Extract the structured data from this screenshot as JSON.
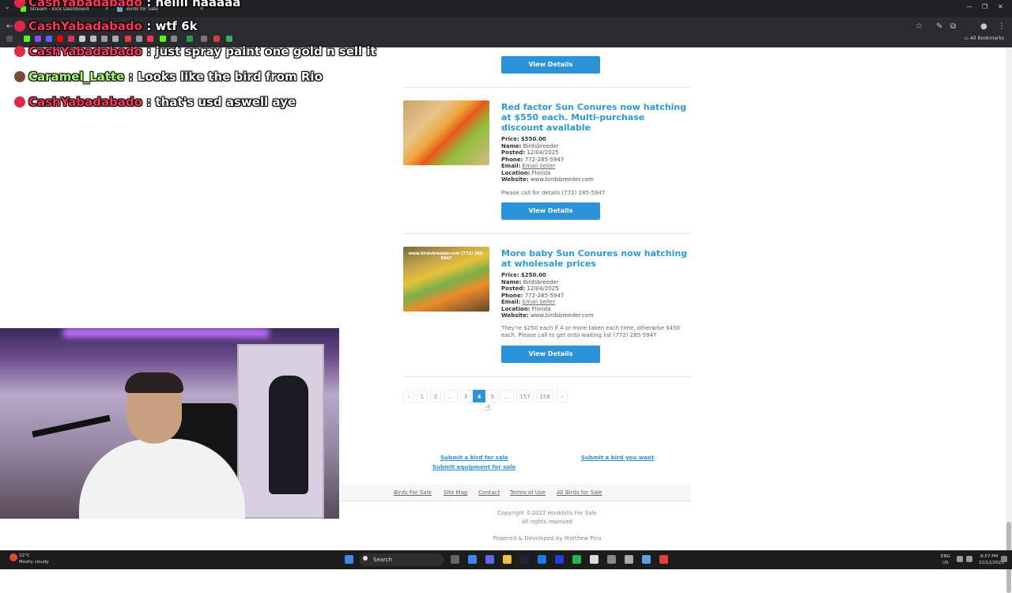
{
  "browser": {
    "tabs": [
      {
        "label": "Stream - Kick Dashboard"
      },
      {
        "label": "Birds for Sale"
      }
    ],
    "bookmarks_label": "All Bookmarks"
  },
  "chat": [
    {
      "user": "CashYabadabado",
      "sep": ":",
      "message": "hellll haaaaa"
    },
    {
      "user": "CashYabadabado",
      "sep": ":",
      "message": "wtf 6k"
    },
    {
      "user": "CashYabadabado",
      "sep": ":",
      "message": "just spray paint one gold n sell it"
    },
    {
      "user": "Caramel_Latte",
      "sep": ":",
      "message": "Looks like the bird from Rio"
    },
    {
      "user": "CashYabadabado",
      "sep": ":",
      "message": "that's usd aswell aye"
    }
  ],
  "listings": [
    {
      "view_label": "View Details"
    },
    {
      "title": "Red factor Sun Conures now hatching at $550 each. Multi-purchase discount available",
      "price_label": "Price:",
      "price": "$550.00",
      "name_label": "Name:",
      "name": "Birdsbreeder",
      "posted_label": "Posted:",
      "posted": "12/04/2025",
      "phone_label": "Phone:",
      "phone": "772-285-5947",
      "email_label": "Email:",
      "email": "Email Seller",
      "location_label": "Location:",
      "location": "Florida",
      "website_label": "Website:",
      "website": "www.birdsbreeder.com",
      "description": "Please call for details (772) 285-5947",
      "view_label": "View Details"
    },
    {
      "title": "More baby Sun Conures now hatching at wholesale prices",
      "watermark": "www.birdsbreeder.com (772) 285-5947",
      "price_label": "Price:",
      "price": "$250.00",
      "name_label": "Name:",
      "name": "Birdsbreeder",
      "posted_label": "Posted:",
      "posted": "12/04/2025",
      "phone_label": "Phone:",
      "phone": "772-285-5947",
      "email_label": "Email:",
      "email": "Email Seller",
      "location_label": "Location:",
      "location": "Florida",
      "website_label": "Website:",
      "website": "www.birdsbreeder.com",
      "description": "They're $250 each if 4 or more taken each time, otherwise $450 each. Please call to get onto waiting list (772) 285-5947",
      "view_label": "View Details"
    }
  ],
  "pagination": {
    "prev": "‹",
    "pages": [
      "1",
      "2",
      "...",
      "3",
      "4",
      "5",
      "...",
      "157",
      "158"
    ],
    "next": "›",
    "current": "4"
  },
  "submit_links": {
    "sale": "Submit a bird for sale",
    "equipment": "Submit equipment for sale",
    "want": "Submit a bird you want"
  },
  "footer": {
    "nav": [
      "Birds For Sale",
      "Site Map",
      "Contact",
      "Terms of Use",
      "All Birds for Sale"
    ],
    "copyright": "Copyright ©2022 Hookbills For Sale",
    "rights": "All rights reserved",
    "powered": "Powered & Developed by Matthew Pico"
  },
  "taskbar": {
    "weather_temp": "22°C",
    "weather_desc": "Mostly cloudy",
    "search_label": "Search",
    "lang": "ENG",
    "region": "US",
    "time": "8:57 PM",
    "date": "22/12/2025"
  },
  "colors": {
    "accent": "#2d93d9",
    "chat_user_red": "#ff3355",
    "chat_user_green": "#a6ff6e"
  }
}
